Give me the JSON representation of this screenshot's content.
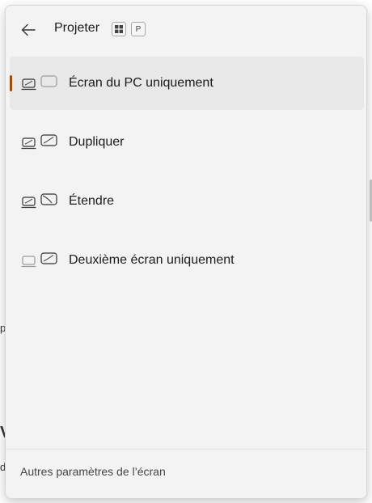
{
  "header": {
    "title": "Projeter",
    "shortcut_key": "P"
  },
  "options": [
    {
      "label": "Écran du PC uniquement",
      "icon": "pc-screen-only-icon",
      "selected": true
    },
    {
      "label": "Dupliquer",
      "icon": "duplicate-icon",
      "selected": false
    },
    {
      "label": "Étendre",
      "icon": "extend-icon",
      "selected": false
    },
    {
      "label": "Deuxième écran uniquement",
      "icon": "second-screen-only-icon",
      "selected": false
    }
  ],
  "footer": {
    "link_label": "Autres paramètres de l’écran"
  },
  "colors": {
    "accent": "#9a4f17",
    "panel_bg": "#f3f3f3",
    "selected_bg": "#e8e8e8"
  }
}
